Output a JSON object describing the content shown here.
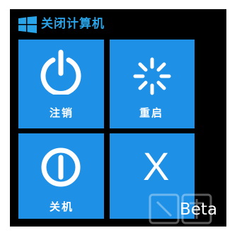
{
  "window": {
    "title": "关闭计算机"
  },
  "tiles": [
    {
      "label": "注销",
      "icon": "power-icon"
    },
    {
      "label": "重启",
      "icon": "restart-spinner-icon"
    },
    {
      "label": "关机",
      "icon": "shutdown-icon"
    },
    {
      "label": "",
      "icon": "close-x-icon",
      "glyph": "X",
      "badge": "Beta"
    }
  ],
  "colors": {
    "tile": "#1e90e6",
    "title": "#29a4e8",
    "background": "#000000"
  }
}
